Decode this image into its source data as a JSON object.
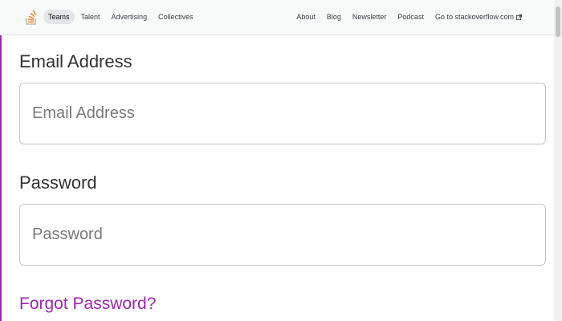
{
  "nav": {
    "logo_icon": "stackoverflow-logo-icon",
    "left_links": [
      "Teams",
      "Talent",
      "Advertising",
      "Collectives"
    ],
    "active_left": "Teams",
    "right_links": [
      "About",
      "Blog",
      "Newsletter",
      "Podcast",
      "Go to stackoverflow.com"
    ],
    "external_icon": "external-link-icon"
  },
  "form": {
    "email_label": "Email Address",
    "email_placeholder": "Email Address",
    "email_value": "",
    "password_label": "Password",
    "password_placeholder": "Password",
    "password_value": "",
    "forgot_link": "Forgot Password?"
  },
  "colors": {
    "accent": "#9c27b0",
    "nav_bg": "#f8f9f9",
    "logo_orange": "#f48024"
  }
}
